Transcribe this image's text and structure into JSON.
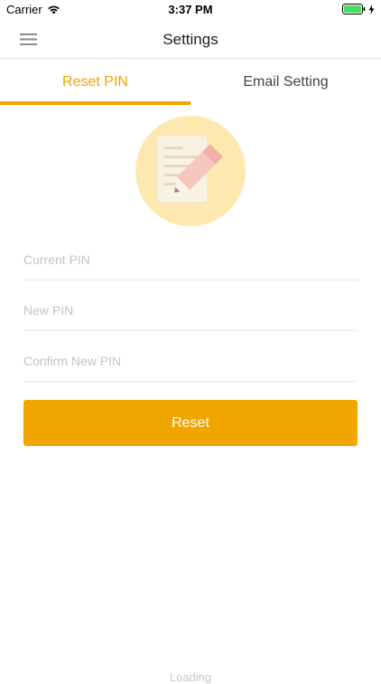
{
  "status_bar": {
    "carrier": "Carrier",
    "time": "3:37 PM"
  },
  "nav": {
    "title": "Settings",
    "menu_icon": "hamburger-menu-icon"
  },
  "tabs": [
    {
      "label": "Reset PIN",
      "active": true
    },
    {
      "label": "Email Setting",
      "active": false
    }
  ],
  "illustration": {
    "icon": "edit-document-icon"
  },
  "form": {
    "current_pin": {
      "value": "",
      "placeholder": "Current PIN"
    },
    "new_pin": {
      "value": "",
      "placeholder": "New PIN"
    },
    "confirm_pin": {
      "value": "",
      "placeholder": "Confirm New PIN"
    },
    "submit_label": "Reset"
  },
  "footer": {
    "loading_text": "Loading"
  },
  "colors": {
    "accent": "#f0a500",
    "illustration_bg": "#fde9b0",
    "battery": "#4cd964"
  }
}
